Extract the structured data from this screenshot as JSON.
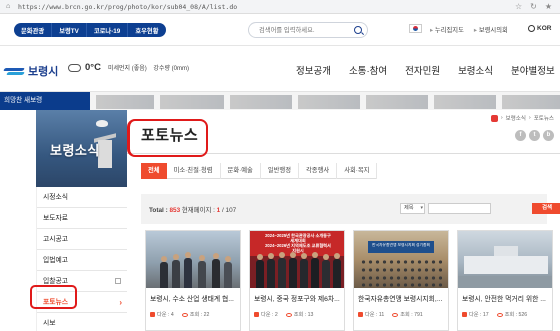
{
  "browser": {
    "url": "https://www.brcn.go.kr/prog/photo/kor/sub04_08/A/list.do"
  },
  "topbar": {
    "quicklinks": [
      "문화관광",
      "보령TV",
      "코로나-19",
      "호우현황"
    ],
    "search_placeholder": "검색어를 입력하세요.",
    "links": [
      "누리집지도",
      "보령시의회"
    ],
    "lang": "KOR"
  },
  "header": {
    "logo": "보령시",
    "weather": {
      "temp": "0°C",
      "fine_dust": "미세먼지 (좋음)",
      "rain": "강수량 (0mm)"
    },
    "gnb": [
      "정보공개",
      "소통·참여",
      "전자민원",
      "보령소식",
      "분야별정보"
    ]
  },
  "strip": {
    "title": "희망찬 새보령"
  },
  "side": {
    "title": "보령소식",
    "menu": [
      "시정소식",
      "보도자료",
      "고시공고",
      "입법예고",
      "입찰공고",
      "포토뉴스",
      "시보"
    ],
    "active_index": 5
  },
  "page": {
    "title": "포토뉴스",
    "breadcrumb": [
      "보령소식",
      "포토뉴스"
    ],
    "social": [
      "f",
      "t",
      "b"
    ]
  },
  "tabs": [
    "전체",
    "미소·친절·청렴",
    "문화·예술",
    "일반행정",
    "각종행사",
    "사회·복지"
  ],
  "list": {
    "total_label": "Total : ",
    "total": "853",
    "page_label": " 현재페이지 : ",
    "page": "1",
    "pages": "/ 107",
    "filter_option": "제목",
    "search_btn": "검색"
  },
  "cards": [
    {
      "title": "보령시, 수소 산업 생태계 협...",
      "downloads": "다운 : 4",
      "views": "조회 : 22"
    },
    {
      "title": "보령시, 중국 정포구와 제6차...",
      "downloads": "다운 : 2",
      "views": "조회 : 13",
      "banner_lines": [
        "2024~2025년 한국관광공사 소개동구",
        "세계대회",
        "2024~2026년 지역제도조 교류협력서",
        "지원시"
      ]
    },
    {
      "title": "한국자유총연맹 보령시지회,...",
      "downloads": "다운 : 11",
      "views": "조회 : 791",
      "banner_lines": [
        "한국자유총연맹 보령시지회 정기총회"
      ]
    },
    {
      "title": "보령시, 안전한 먹거리 위한 ...",
      "downloads": "다운 : 17",
      "views": "조회 : 526"
    }
  ]
}
